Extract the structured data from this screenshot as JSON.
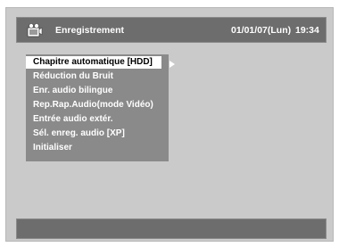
{
  "header": {
    "title": "Enregistrement",
    "date": "01/01/07(Lun)",
    "time": "19:34",
    "icon": "recording-setup-icon"
  },
  "menu": {
    "items": [
      {
        "label": "Chapitre automatique [HDD]"
      },
      {
        "label": "Réduction du Bruit"
      },
      {
        "label": "Enr. audio bilingue"
      },
      {
        "label": "Rep.Rap.Audio(mode Vidéo)"
      },
      {
        "label": "Entrée audio extér."
      },
      {
        "label": "Sél. enreg. audio [XP]"
      },
      {
        "label": "Initialiser"
      }
    ],
    "selected_index": 0
  },
  "status_bar": {
    "text": ""
  },
  "colors": {
    "background": "#cacaca",
    "bar": "#6d6d6d",
    "menu_bg": "#8a8a8a",
    "highlight": "#ffffff"
  }
}
